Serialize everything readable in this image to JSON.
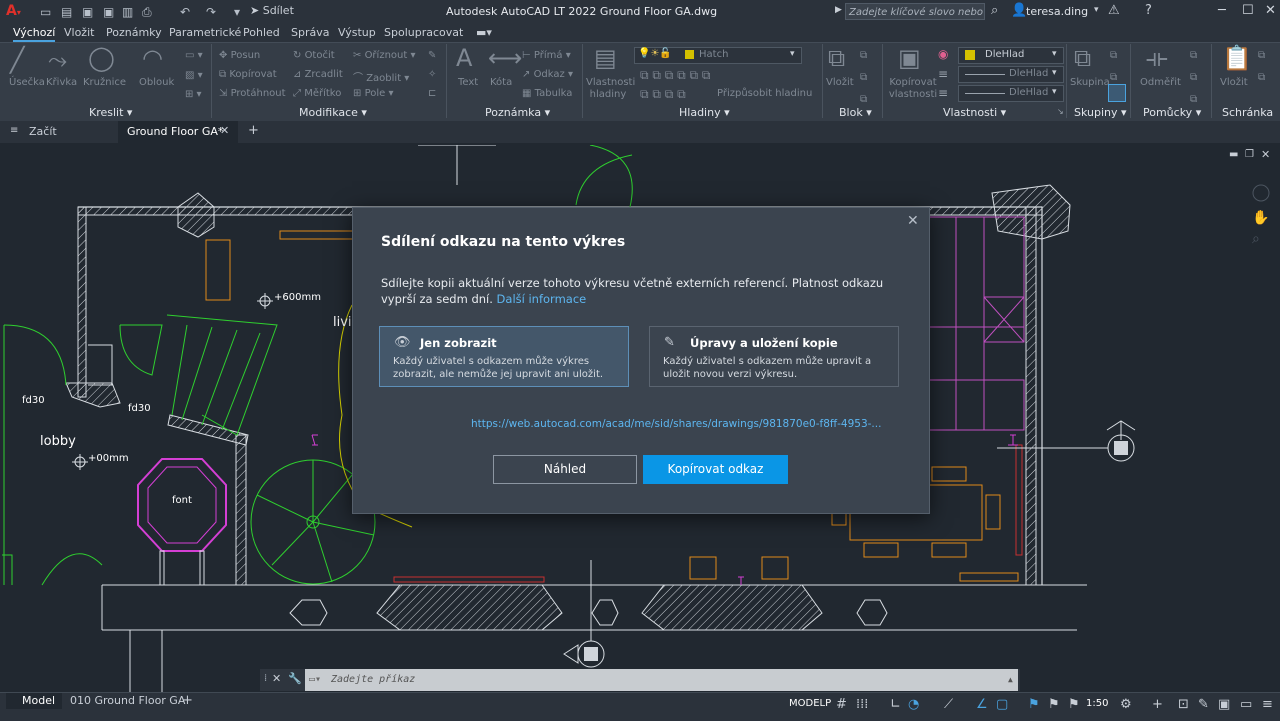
{
  "title_bar": {
    "share_label": "Sdílet",
    "window_title": "Autodesk AutoCAD LT 2022    Ground Floor  GA.dwg",
    "search_placeholder": "Zadejte klíčové slovo nebo výraz",
    "user_name": "teresa.ding"
  },
  "ribbon_tabs": [
    "Výchozí",
    "Vložit",
    "Poznámky",
    "Parametrické",
    "Pohled",
    "Správa",
    "Výstup",
    "Spolupracovat"
  ],
  "ribbon": {
    "draw": {
      "title": "Kreslit",
      "tools": [
        "Úsečka",
        "Křivka",
        "Kružnice",
        "Oblouk"
      ]
    },
    "modify": {
      "title": "Modifikace",
      "tools": [
        "Posun",
        "Otočit",
        "Oříznout",
        "Kopírovat",
        "Zrcadlit",
        "Zaoblit",
        "Protáhnout",
        "Měřítko",
        "Pole"
      ]
    },
    "annotation": {
      "title": "Poznámka",
      "tools": [
        "Text",
        "Kóta",
        "Přímá",
        "Odkaz",
        "Tabulka"
      ]
    },
    "layers": {
      "title": "Hladiny",
      "tools": [
        "Vlastnosti hladiny",
        "Přizpůsobit hladinu"
      ],
      "current_layer": "Hatch"
    },
    "block": {
      "title": "Blok",
      "tools": [
        "Vložit"
      ]
    },
    "properties": {
      "title": "Vlastnosti",
      "tools": [
        "Kopírovat vlastnosti"
      ],
      "values": [
        "DleHlad",
        "DleHlad",
        "DleHlad"
      ]
    },
    "groups": {
      "title": "Skupiny",
      "tools": [
        "Skupina"
      ]
    },
    "utilities": {
      "title": "Pomůcky",
      "tools": [
        "Odměřit"
      ]
    },
    "clipboard": {
      "title": "Schránka",
      "tools": [
        "Vložit"
      ]
    }
  },
  "doc_tabs": [
    "Začít",
    "Ground Floor  GA*"
  ],
  "drawing_labels": {
    "lobby": "lobby",
    "fd30_a": "fd30",
    "fd30_b": "fd30",
    "font": "font",
    "dim_600": "+600mm",
    "dim_00": "+00mm",
    "living": "livi"
  },
  "modal": {
    "title": "Sdílení odkazu na tento výkres",
    "description": "Sdílejte kopii aktuální verze tohoto výkresu včetně externích referencí. Platnost odkazu vyprší za sedm dní.",
    "more_info": "Další informace",
    "option_view": {
      "title": "Jen zobrazit",
      "desc": "Každý uživatel s odkazem může výkres zobrazit, ale nemůže jej upravit ani uložit."
    },
    "option_edit": {
      "title": "Úpravy a uložení kopie",
      "desc": "Každý uživatel s odkazem může upravit a uložit novou verzi výkresu."
    },
    "url": "https://web.autocad.com/acad/me/sid/shares/drawings/981870e0-f8ff-4953-...",
    "preview_button": "Náhled",
    "copy_button": "Kopírovat odkaz"
  },
  "command_line": {
    "placeholder": "Zadejte příkaz"
  },
  "status_bar": {
    "layout_tabs": [
      "Model",
      "010 Ground Floor GA"
    ],
    "mode": "MODELP",
    "scale": "1:50"
  },
  "colors": {
    "accent": "#0a96e6",
    "link": "#5db6f0"
  }
}
